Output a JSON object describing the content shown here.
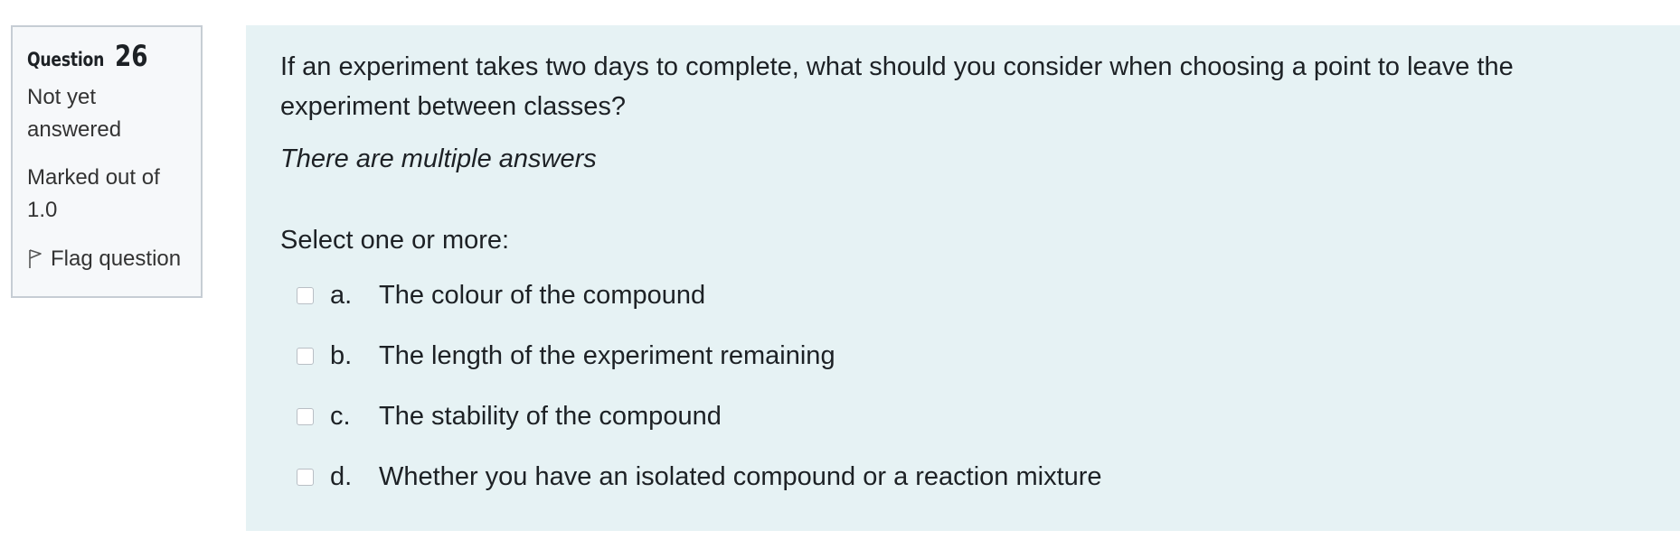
{
  "info": {
    "question_word": "Question",
    "question_number": "26",
    "state": "Not yet answered",
    "grade": "Marked out of 1.0",
    "flag_label": "Flag question"
  },
  "question": {
    "text": "If an experiment takes two days to complete, what should you consider when choosing a point to leave the experiment between classes?",
    "hint": "There are multiple answers",
    "prompt": "Select one or more:",
    "answers": [
      {
        "letter": "a.",
        "label": "The colour of the compound",
        "checked": false
      },
      {
        "letter": "b.",
        "label": "The length of the experiment remaining",
        "checked": false
      },
      {
        "letter": "c.",
        "label": "The stability of the compound",
        "checked": false
      },
      {
        "letter": "d.",
        "label": "Whether you have an isolated compound or a reaction mixture",
        "checked": false
      }
    ]
  },
  "colors": {
    "info_background": "#f6f8fa",
    "info_border": "#c6cdd4",
    "formulation_background": "#e6f2f4",
    "text": "#1d2125"
  },
  "icons": {
    "flag": "flag-icon"
  }
}
